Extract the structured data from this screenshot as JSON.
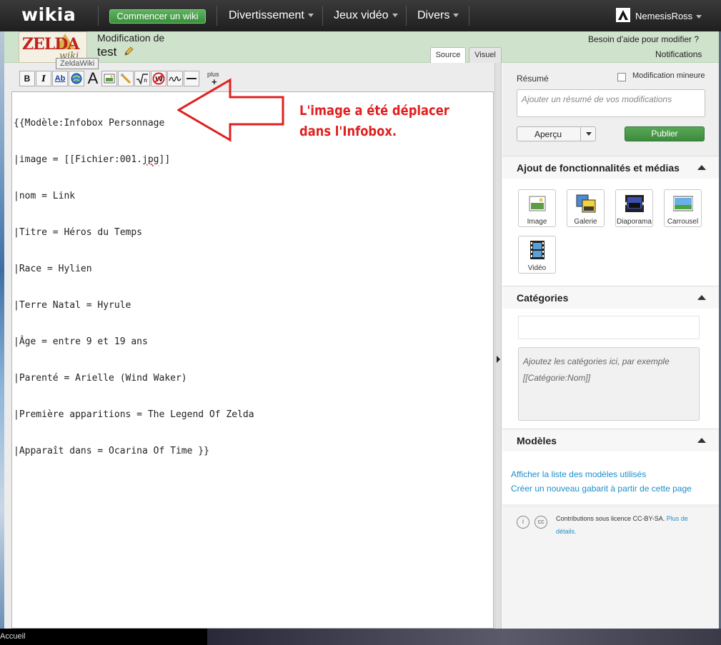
{
  "topbar": {
    "logo": "wikia",
    "start_wiki": "Commencer un wiki",
    "nav": [
      "Divertissement",
      "Jeux vidéo",
      "Divers"
    ],
    "username": "NemesisRoss"
  },
  "header": {
    "wiki_logo_text": "ZELDA",
    "wiki_logo_sub": "wiki",
    "wiki_tooltip": "ZeldaWiki",
    "editing_label": "Modification de",
    "page_title": "test",
    "help_link": "Besoin d'aide pour modifier ?",
    "notifications": "Notifications",
    "tabs": {
      "source": "Source",
      "visual": "Visuel"
    }
  },
  "toolbar": {
    "buttons": [
      "bold-icon",
      "italic-icon",
      "internal-link-icon",
      "external-link-icon",
      "heading-icon",
      "image-icon",
      "media-icon",
      "math-icon",
      "nowiki-icon",
      "signature-icon",
      "horizontal-line-icon"
    ],
    "bold": "B",
    "italic": "I",
    "link": "Ab",
    "heading": "A",
    "more_label": "plus",
    "more_sign": "+"
  },
  "editor": {
    "lines": [
      "{{Modèle:Infobox Personnage",
      "|image = [[Fichier:001.",
      "|nom = Link",
      "|Titre = Héros du Temps",
      "|Race = Hylien",
      "|Terre Natal = Hyrule",
      "|Âge = entre 9 et 19 ans",
      "|Parenté = Arielle (Wind Waker)",
      "|Première apparitions = The Legend Of Zelda",
      "|Apparaît dans = Ocarina Of Time }}"
    ],
    "line2_misspelled": "jpg",
    "line2_end": "]]"
  },
  "annotation": {
    "line1": "L'image a été déplacer",
    "line2": "dans l'Infobox.",
    "color": "#e02020"
  },
  "rail": {
    "summary_label": "Résumé",
    "minor_edit": "Modification mineure",
    "summary_placeholder": "Ajouter un résumé de vos modifications",
    "preview": "Aperçu",
    "publish": "Publier",
    "features_title": "Ajout de fonctionnalités et médias",
    "media": [
      "Image",
      "Galerie",
      "Diaporama",
      "Carrousel",
      "Vidéo"
    ],
    "categories_title": "Catégories",
    "categories_placeholder_1": "Ajoutez les catégories ici, par exemple",
    "categories_placeholder_2": "[[Catégorie:Nom]]",
    "templates_title": "Modèles",
    "template_links": [
      "Afficher la liste des modèles utilisés",
      "Créer un nouveau gabarit à partir de cette page"
    ],
    "license_text": "Contributions sous licence CC-BY-SA.",
    "license_link_1": "Plus de",
    "license_link_2": "détails."
  },
  "taskbar": {
    "home": "Accueil"
  },
  "colors": {
    "accent_green": "#3e8a3e",
    "link_blue": "#1d8fc9",
    "header_green": "#cfe3cc"
  }
}
